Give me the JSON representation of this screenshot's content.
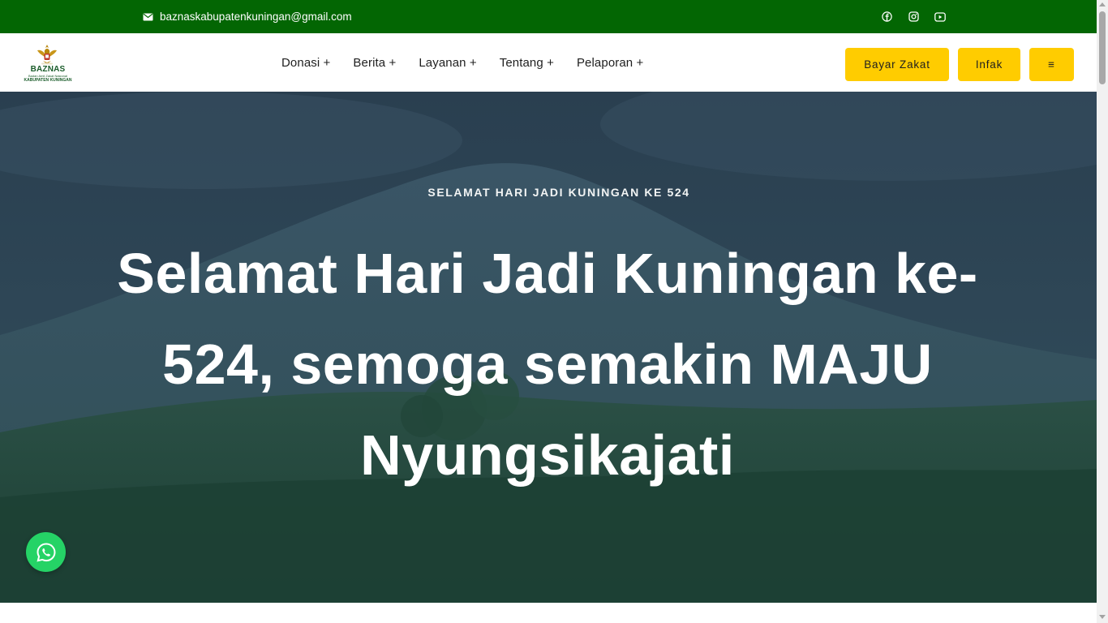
{
  "topbar": {
    "email": "baznaskabupatenkuningan@gmail.com",
    "email_icon": "envelope-icon",
    "socials": [
      "facebook-icon",
      "instagram-icon",
      "youtube-icon"
    ],
    "background": "#036603"
  },
  "header": {
    "logo": {
      "brand": "BAZNAS",
      "subtitle": "Badan Amil Zakat Nasional",
      "region": "KABUPATEN KUNINGAN"
    },
    "nav": [
      {
        "label": "Donasi +"
      },
      {
        "label": "Berita +"
      },
      {
        "label": "Layanan +"
      },
      {
        "label": "Tentang +"
      },
      {
        "label": "Pelaporan +"
      }
    ],
    "buttons": {
      "zakat": "Bayar Zakat",
      "infak": "Infak",
      "menu": "≡"
    },
    "accent": "#ffcc00"
  },
  "hero": {
    "kicker": "SELAMAT HARI JADI KUNINGAN KE 524",
    "headline": "Selamat Hari Jadi Kuningan ke-524, semoga semakin MAJU Nyungsikajati"
  },
  "whatsapp": {
    "icon": "whatsapp-icon",
    "color": "#25d366"
  }
}
